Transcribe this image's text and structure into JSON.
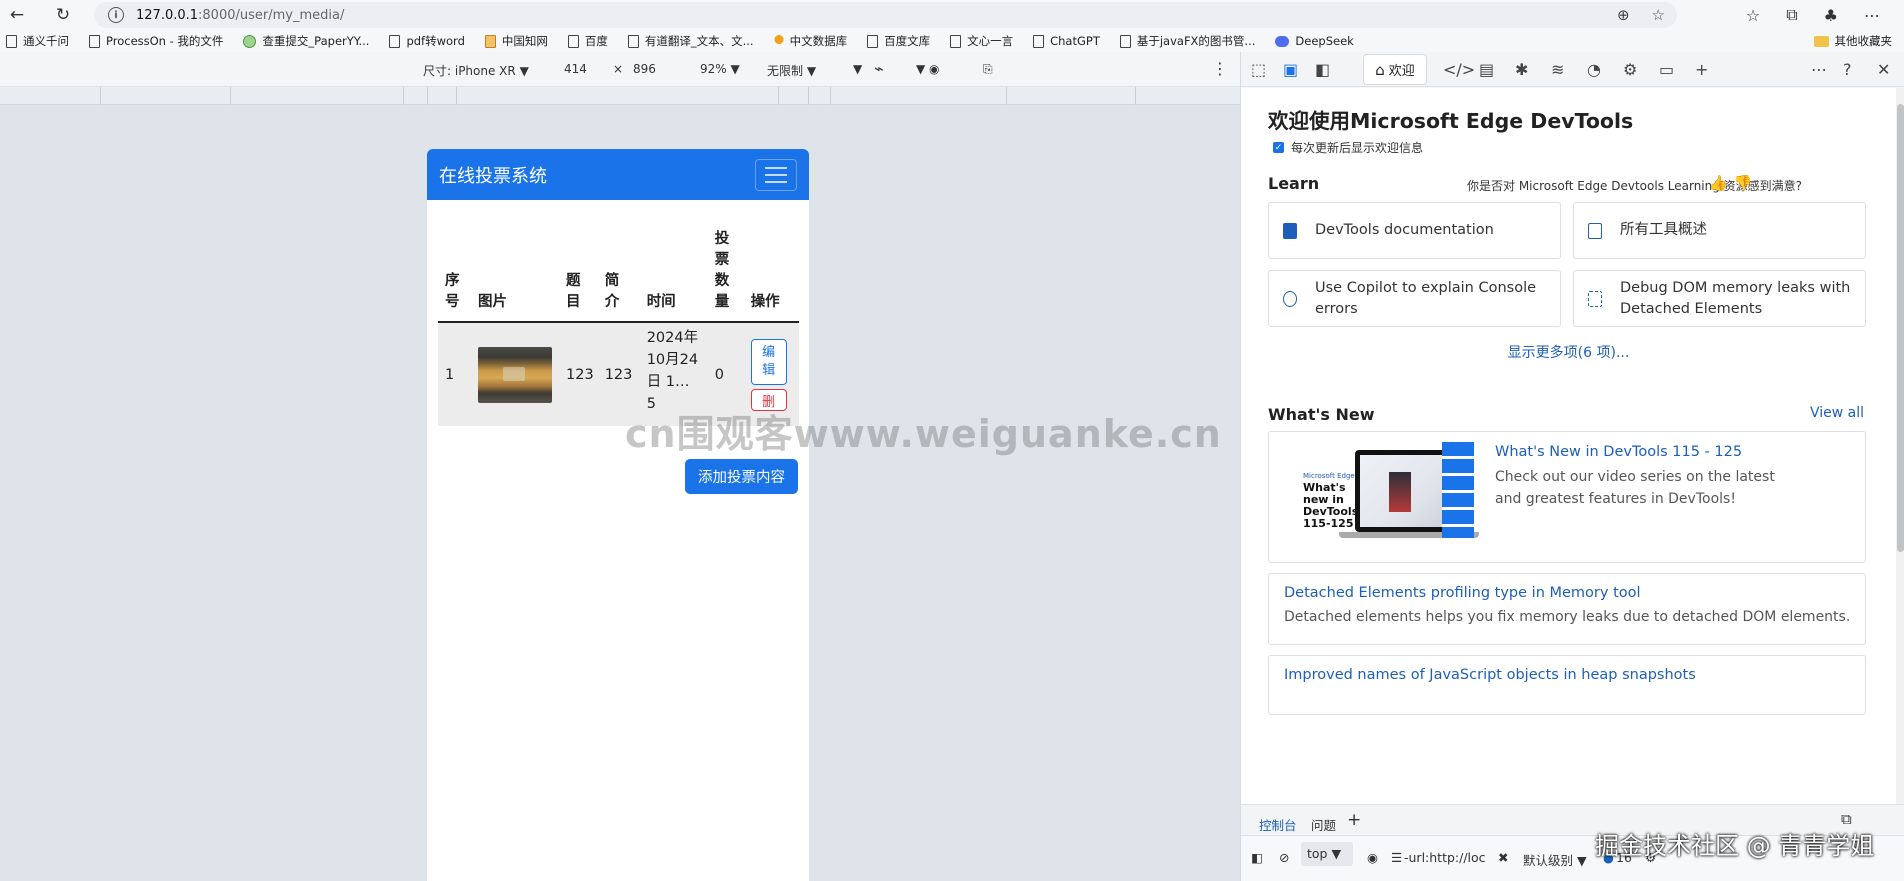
{
  "browser": {
    "url_host": "127.0.0.1",
    "url_path": ":8000/user/my_media/",
    "bookmarks": [
      "通义千问",
      "ProcessOn - 我的文件",
      "查重提交_PaperYY...",
      "pdf转word",
      "中国知网",
      "百度",
      "有道翻译_文本、文...",
      "中文数据库",
      "百度文库",
      "文心一言",
      "ChatGPT",
      "基于javaFX的图书管...",
      "DeepSeek"
    ],
    "other_bookmarks": "其他收藏夹"
  },
  "device_toolbar": {
    "size_label": "尺寸: iPhone XR",
    "width": "414",
    "times": "×",
    "height": "896",
    "zoom": "92%",
    "throttle": "无限制"
  },
  "app": {
    "title": "在线投票系统",
    "table": {
      "headers": [
        "序号",
        "图片",
        "题目",
        "简介",
        "时间",
        "投票数量",
        "操作"
      ],
      "rows": [
        {
          "index": "1",
          "title": "123",
          "intro": "123",
          "time": "2024年10月24日 1…5",
          "votes": "0",
          "edit": "编辑",
          "delete": "删除"
        }
      ]
    },
    "add_button": "添加投票内容"
  },
  "devtools": {
    "welcome_tab": "欢迎",
    "heading": "欢迎使用Microsoft Edge DevTools",
    "show_welcome": "每次更新后显示欢迎信息",
    "learn": "Learn",
    "feedback": "你是否对 Microsoft Edge Devtools Learning 资源感到满意?",
    "cards": [
      "DevTools documentation",
      "所有工具概述",
      "Use Copilot to explain Console errors",
      "Debug DOM memory leaks with Detached Elements"
    ],
    "show_more": "显示更多项(6 项)...",
    "whats_new": "What's New",
    "view_all": "View all",
    "promo": {
      "brand": "Microsoft Edge",
      "text": "What's new in DevTools 115-125"
    },
    "news": [
      {
        "title": "What's New in DevTools 115 - 125",
        "desc": "Check out our video series on the latest and greatest features in DevTools!"
      },
      {
        "title": "Detached Elements profiling type in Memory tool",
        "desc": "Detached elements helps you fix memory leaks due to detached DOM elements."
      },
      {
        "title": "Improved names of JavaScript objects in heap snapshots",
        "desc": ""
      }
    ],
    "drawer": {
      "tab_console": "控制台",
      "tab_issues": "问题",
      "context": "top",
      "filter": "-url:http://loc",
      "level": "默认级别",
      "count": "16"
    }
  },
  "watermarks": {
    "center": "cn围观客www.weiguanke.cn",
    "corner": "掘金技术社区 @ 青青学姐"
  }
}
